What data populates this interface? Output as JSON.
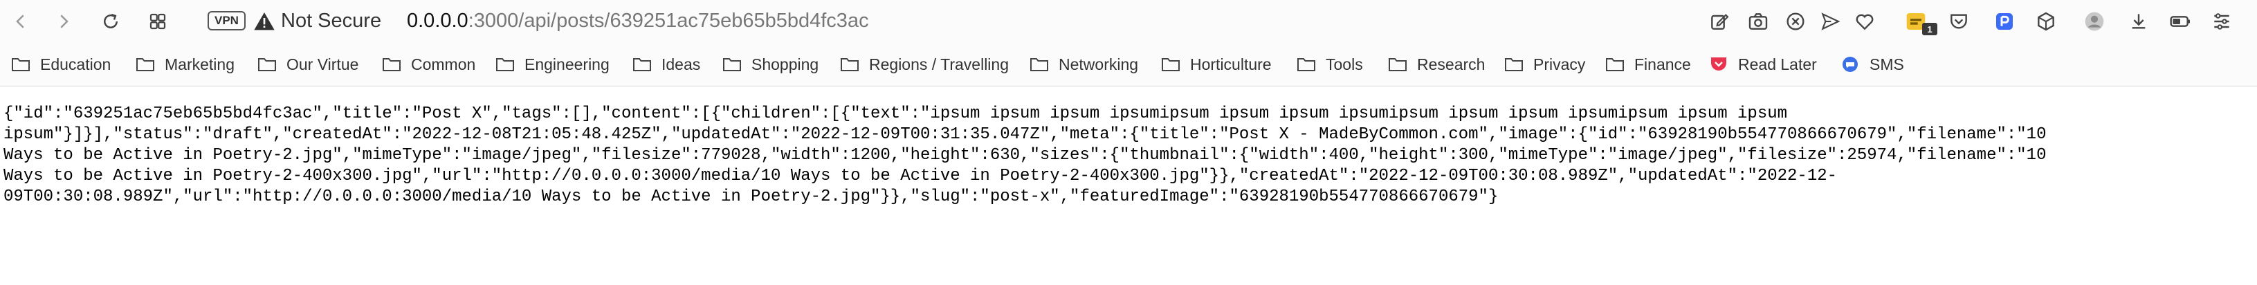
{
  "toolbar": {
    "vpn_label": "VPN",
    "security_label": "Not Secure",
    "url_host": "0.0.0.0",
    "url_path": ":3000/api/posts/639251ac75eb65b5bd4fc3ac",
    "extension_badge_count": "1",
    "icons": [
      "back-icon",
      "forward-icon",
      "reload-icon",
      "tab-grid-icon",
      "edit-icon",
      "camera-icon",
      "block-icon",
      "send-icon",
      "heart-icon",
      "extension-icon",
      "pocket-icon",
      "bookmark-app-icon",
      "box-icon",
      "profile-icon",
      "download-icon",
      "battery-icon",
      "menu-icon"
    ]
  },
  "bookmarks": [
    {
      "label": "Education",
      "icon": "folder-icon"
    },
    {
      "label": "Marketing",
      "icon": "folder-icon"
    },
    {
      "label": "Our Virtue",
      "icon": "folder-icon"
    },
    {
      "label": "Common",
      "icon": "folder-icon"
    },
    {
      "label": "Engineering",
      "icon": "folder-icon"
    },
    {
      "label": "Ideas",
      "icon": "folder-icon"
    },
    {
      "label": "Shopping",
      "icon": "folder-icon"
    },
    {
      "label": "Regions / Travelling",
      "icon": "folder-icon"
    },
    {
      "label": "Networking",
      "icon": "folder-icon"
    },
    {
      "label": "Horticulture",
      "icon": "folder-icon"
    },
    {
      "label": "Tools",
      "icon": "folder-icon"
    },
    {
      "label": "Research",
      "icon": "folder-icon"
    },
    {
      "label": "Privacy",
      "icon": "folder-icon"
    },
    {
      "label": "Finance",
      "icon": "folder-icon"
    },
    {
      "label": "Read Later",
      "icon": "pocket-icon",
      "color": "#e8344e"
    },
    {
      "label": "SMS",
      "icon": "chat-icon",
      "color": "#3a6fe8"
    }
  ],
  "json_lines": [
    "{\"id\":\"639251ac75eb65b5bd4fc3ac\",\"title\":\"Post X\",\"tags\":[],\"content\":[{\"children\":[{\"text\":\"ipsum ipsum ipsum ipsumipsum ipsum ipsum ipsumipsum ipsum ipsum ipsumipsum ipsum ipsum",
    "ipsum\"}]}],\"status\":\"draft\",\"createdAt\":\"2022-12-08T21:05:48.425Z\",\"updatedAt\":\"2022-12-09T00:31:35.047Z\",\"meta\":{\"title\":\"Post X - MadeByCommon.com\",\"image\":{\"id\":\"63928190b554770866670679\",\"filename\":\"10",
    "Ways to be Active in Poetry-2.jpg\",\"mimeType\":\"image/jpeg\",\"filesize\":779028,\"width\":1200,\"height\":630,\"sizes\":{\"thumbnail\":{\"width\":400,\"height\":300,\"mimeType\":\"image/jpeg\",\"filesize\":25974,\"filename\":\"10",
    "Ways to be Active in Poetry-2-400x300.jpg\",\"url\":\"http://0.0.0.0:3000/media/10 Ways to be Active in Poetry-2-400x300.jpg\"}},\"createdAt\":\"2022-12-09T00:30:08.989Z\",\"updatedAt\":\"2022-12-",
    "09T00:30:08.989Z\",\"url\":\"http://0.0.0.0:3000/media/10 Ways to be Active in Poetry-2.jpg\"}},\"slug\":\"post-x\",\"featuredImage\":\"63928190b554770866670679\"}"
  ],
  "colors": {
    "toolbar_bg": "#fbfbfb",
    "read_later": "#e8344e",
    "sms": "#3a6fe8",
    "bookmark_app": "#3b6cf6",
    "extension_yellow": "#f2c230"
  }
}
